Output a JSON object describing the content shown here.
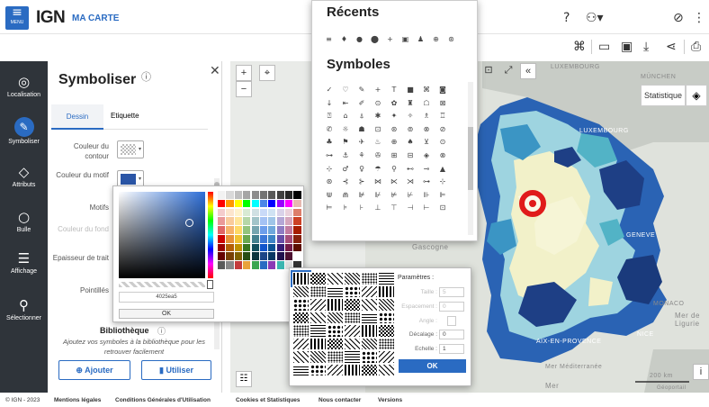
{
  "header": {
    "menu_label": "MENU",
    "logo": "IGN",
    "app_name": "MA CARTE"
  },
  "rail": [
    {
      "label": "Localisation",
      "icon": "target-icon"
    },
    {
      "label": "Symboliser",
      "icon": "pencil-icon"
    },
    {
      "label": "Attributs",
      "icon": "tag-icon"
    },
    {
      "label": "Bulle",
      "icon": "speech-bubble-icon"
    },
    {
      "label": "Affichage",
      "icon": "list-icon"
    },
    {
      "label": "Sélectionner",
      "icon": "magnifier-icon"
    }
  ],
  "panel": {
    "title": "Symboliser",
    "tabs": [
      "Dessin",
      "Etiquette"
    ],
    "rows": {
      "contour": "Couleur du contour",
      "motif_color": "Couleur du motif",
      "motifs": "Motifs",
      "fond": "Couleur du fond",
      "epaisseur": "Epaisseur de trait",
      "pointilles": "Pointillés"
    },
    "library": {
      "title": "Bibliothèque",
      "text": "Ajoutez vos symboles à la bibliothèque pour les retrouver facilement",
      "add": "Ajouter",
      "use": "Utiliser"
    }
  },
  "color_picker": {
    "hex": "4025ea5",
    "ok": "OK",
    "palette": [
      "#f2f2f2",
      "#d9d9d9",
      "#bfbfbf",
      "#a6a6a6",
      "#8c8c8c",
      "#737373",
      "#595959",
      "#404040",
      "#262626",
      "#000000",
      "#ff0000",
      "#ff9900",
      "#ffff00",
      "#00ff00",
      "#00ffff",
      "#4a86e8",
      "#0000ff",
      "#9900ff",
      "#ff00ff",
      "#e6b8af",
      "#f4cccc",
      "#fce5cd",
      "#fff2cc",
      "#d9ead3",
      "#d0e0e3",
      "#c9daf8",
      "#cfe2f3",
      "#d9d2e9",
      "#ead1dc",
      "#dd7e6b",
      "#ea9999",
      "#f9cb9c",
      "#ffe599",
      "#b6d7a8",
      "#a2c4c9",
      "#a4c2f4",
      "#9fc5e8",
      "#b4a7d6",
      "#d5a6bd",
      "#cc4125",
      "#e06666",
      "#f6b26b",
      "#ffd966",
      "#93c47d",
      "#76a5af",
      "#6d9eeb",
      "#6fa8dc",
      "#8e7cc3",
      "#c27ba0",
      "#a61c00",
      "#cc0000",
      "#e69138",
      "#f1c232",
      "#6aa84f",
      "#45818e",
      "#3c78d8",
      "#3d85c6",
      "#674ea7",
      "#a64d79",
      "#85200c",
      "#990000",
      "#b45f06",
      "#bf9000",
      "#38761d",
      "#134f5c",
      "#1155cc",
      "#0b5394",
      "#351c75",
      "#741b47",
      "#5b0f00",
      "#660000",
      "#783f04",
      "#7f6000",
      "#274e13",
      "#0c343d",
      "#1c4587",
      "#073763",
      "#20124d",
      "#4c1130",
      "#ffffff",
      "#5b5b5b",
      "#888888",
      "#c43b3b",
      "#e8a23a",
      "#3aa650",
      "#2a6bc2",
      "#8a3ab5",
      "#3ab5b0",
      "#e0e0e0",
      "#333333"
    ]
  },
  "symbols": {
    "recents_title": "Récents",
    "symbols_title": "Symboles",
    "recents": [
      "≡",
      "♦",
      "●",
      "⬤",
      "+",
      "▣",
      "♟",
      "⊕",
      "⊛"
    ],
    "grid": [
      "✓",
      "♡",
      "✎",
      "+",
      "T",
      "■",
      "⌘",
      "◙",
      "▾",
      "↓",
      "⇤",
      "✐",
      "⊙",
      "✿",
      "♜",
      "☖",
      "⊠",
      "♙",
      "⍰",
      "⌂",
      "⍋",
      "✱",
      "✦",
      "✧",
      "♗",
      "♖",
      "⊞",
      "✆",
      "☼",
      "☗",
      "⊡",
      "⊛",
      "⊚",
      "⊗",
      "⊘",
      "⊜",
      "♣",
      "⚑",
      "✈",
      "♨",
      "⊕",
      "♠",
      "⊻",
      "⊙",
      "✚",
      "⊶",
      "⚓",
      "⚘",
      "✇",
      "⊞",
      "⊟",
      "◈",
      "⊗",
      "⊕",
      "⊹",
      "♂",
      "♀",
      "☂",
      "⚲",
      "⊷",
      "⊸",
      "▲",
      "⊿",
      "⊛",
      "⊰",
      "⊱",
      "⋈",
      "⋉",
      "⋊",
      "⊶",
      "⊹",
      "⋔",
      "⋓",
      "⋒",
      "⊯",
      "⊮",
      "⊭",
      "⊬",
      "⊪",
      "⊫",
      "⊩",
      "⊨",
      "⊧",
      "⊦",
      "⊥",
      "⊤",
      "⊣",
      "⊢",
      "⊡",
      "⊠"
    ]
  },
  "pattern": {
    "params_title": "Paramètres :",
    "taille_label": "Taille :",
    "taille": "5",
    "espacement_label": "Espacement :",
    "espacement": "0",
    "angle_label": "Angle :",
    "decalage_label": "Décalage :",
    "decalage": "0",
    "echelle_label": "Echelle :",
    "echelle": "1",
    "ok": "OK"
  },
  "map": {
    "stat_label": "Statistique",
    "labels": [
      "LUXEMBOURG",
      "LUXEMBOURG",
      "MÜNCHEN",
      "GENEVE",
      "Gascogne",
      "MONACO",
      "Mer de Ligurie",
      "NICE",
      "AIX-EN-PROVENCE",
      "Mer Méditerranée",
      "Mer"
    ],
    "scale": "200 km",
    "attribution": "Géoportail"
  },
  "footer": {
    "copyright": "© IGN - 2023",
    "links": [
      "Mentions légales",
      "Conditions Générales d'Utilisation",
      "Cookies et Statistiques",
      "Nous contacter",
      "Versions"
    ]
  }
}
